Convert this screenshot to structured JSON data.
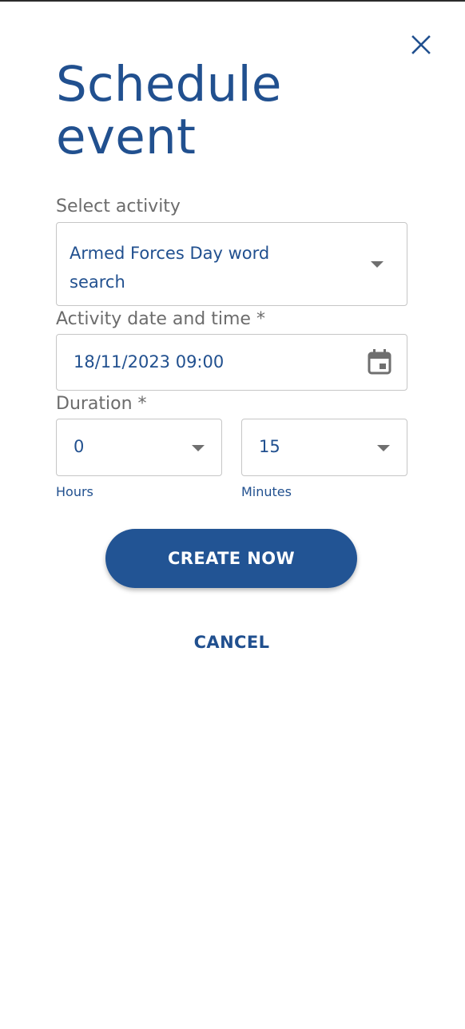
{
  "dialog": {
    "title_line1": "Schedule",
    "title_line2": "event",
    "close_icon": "close-icon"
  },
  "activity": {
    "label": "Select activity",
    "value_line1": "Armed Forces Day word",
    "value_line2": "search",
    "icon": "chevron-down-icon"
  },
  "datetime": {
    "label": "Activity date and time *",
    "value": "18/11/2023 09:00",
    "icon": "calendar-icon"
  },
  "duration": {
    "label": "Duration *",
    "hours": {
      "value": "0",
      "caption": "Hours"
    },
    "minutes": {
      "value": "15",
      "caption": "Minutes"
    }
  },
  "actions": {
    "create_label": "CREATE NOW",
    "cancel_label": "CANCEL"
  },
  "colors": {
    "accent": "#21508f",
    "button": "#225494",
    "label": "#6c6c6c",
    "border": "#c6c6c6"
  }
}
